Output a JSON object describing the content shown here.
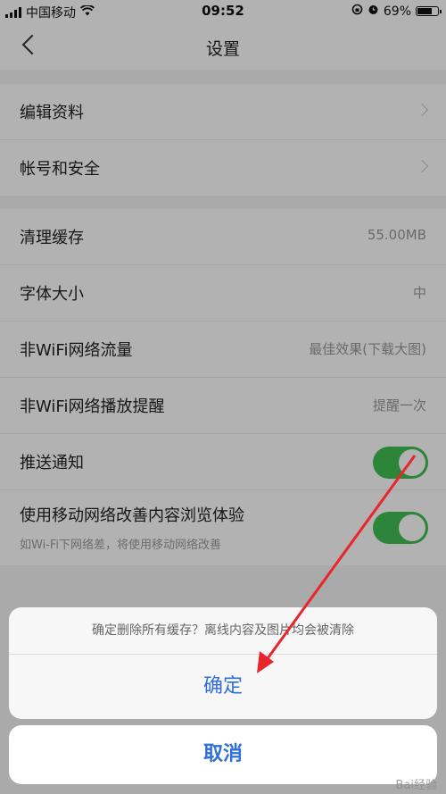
{
  "status_bar": {
    "carrier": "中国移动",
    "time": "09:52",
    "battery": "69%"
  },
  "nav": {
    "title": "设置"
  },
  "group1": [
    {
      "label": "编辑资料"
    },
    {
      "label": "帐号和安全"
    }
  ],
  "group2": {
    "cache": {
      "label": "清理缓存",
      "value": "55.00MB"
    },
    "font": {
      "label": "字体大小",
      "value": "中"
    },
    "wifi_traffic": {
      "label": "非WiFi网络流量",
      "value": "最佳效果(下载大图)"
    },
    "wifi_play": {
      "label": "非WiFi网络播放提醒",
      "value": "提醒一次"
    },
    "push": {
      "label": "推送通知",
      "on": true
    },
    "mobile": {
      "label": "使用移动网络改善内容浏览体验",
      "sub": "如Wi-Fi下网络差，将使用移动网络改善",
      "on": true
    }
  },
  "sheet": {
    "message": "确定删除所有缓存？离线内容及图片均会被清除",
    "confirm": "确定",
    "cancel": "取消"
  },
  "watermark": "Bai经验",
  "colors": {
    "accent": "#2f6fd6",
    "toggle_on": "#3fbf52",
    "arrow": "#e8252b"
  }
}
